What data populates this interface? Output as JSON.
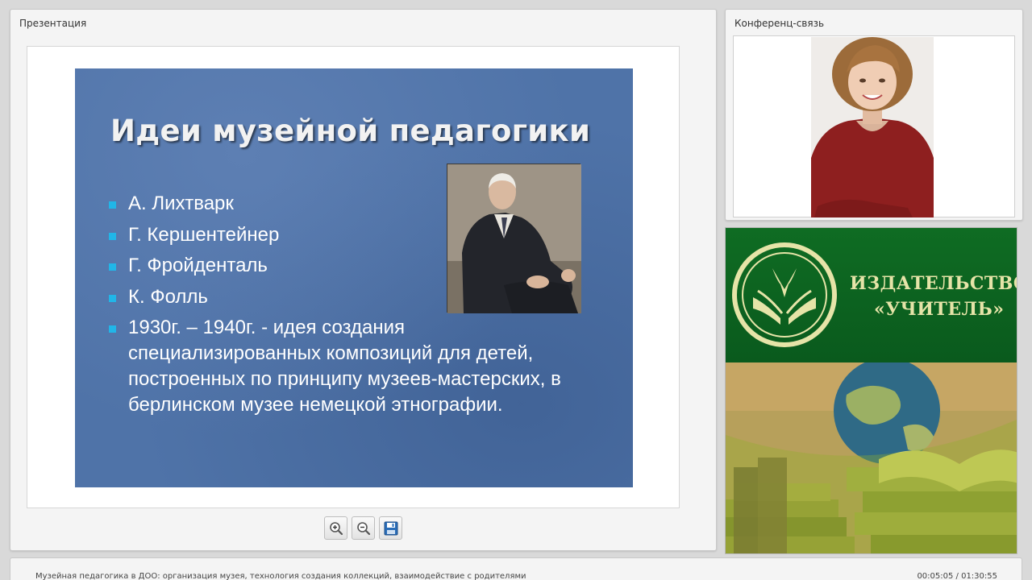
{
  "presentation": {
    "panel_title": "Презентация",
    "slide": {
      "title": "Идеи музейной педагогики",
      "items": [
        "А. Лихтварк",
        "Г. Кершентейнер",
        "Г. Фройденталь",
        "К. Фолль",
        "1930г. – 1940г. - идея  создания специализированных композиций  для детей, построенных по принципу музеев-мастерских, в берлинском музее  немецкой этнографии."
      ]
    },
    "toolbar": {
      "zoom_in_icon": "zoom-in-icon",
      "zoom_out_icon": "zoom-out-icon",
      "save_icon": "save-icon"
    }
  },
  "conference": {
    "panel_title": "Конференц-связь"
  },
  "advert": {
    "brand_line1": "ИЗДАТЕЛЬСТВО",
    "brand_line2": "«УЧИТЕЛЬ»"
  },
  "footer": {
    "title": "Музейная педагогика в ДОО: организация музея, технология создания коллекций, взаимодействие с родителями",
    "time": "00:05:05 / 01:30:55"
  },
  "colors": {
    "slide_bg": "#4f73a8",
    "bullet": "#21b6e8",
    "ad_green": "#0f6c23",
    "ad_text": "#e6e4a8"
  }
}
